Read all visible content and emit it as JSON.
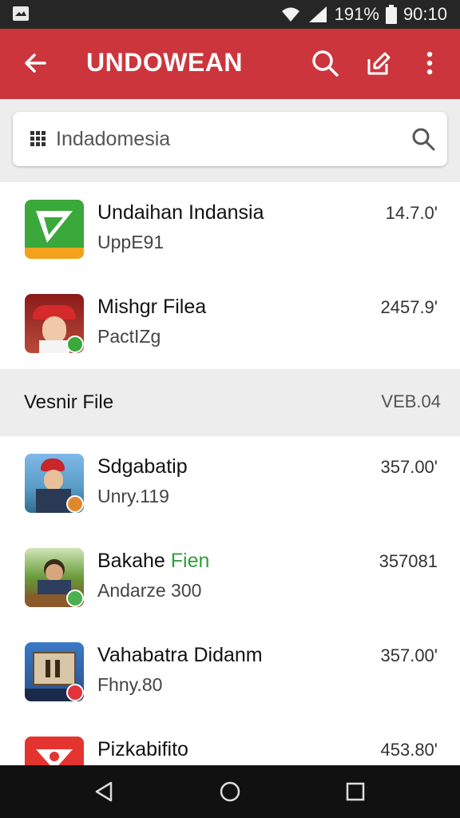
{
  "status": {
    "battery": "191%",
    "time": "90:10"
  },
  "header": {
    "title": "UNDOWEAN",
    "accent": "#cc353c"
  },
  "search": {
    "query": "Indadomesia"
  },
  "list_top": [
    {
      "name": "Undaihan Indansia",
      "sub": "UppE91",
      "value": "14.7.0'",
      "icon": "green-play-app-icon"
    },
    {
      "name": "Mishgr Filea",
      "sub": "PactIZg",
      "value": "2457.9'",
      "icon": "child-red-hat-photo-icon"
    }
  ],
  "section": {
    "label": "Vesnir File",
    "count": "VEB.04"
  },
  "list_bottom": [
    {
      "name": "Sdgabatip",
      "sub": "Unry.119",
      "value": "357.00'",
      "icon": "child-lake-photo-icon"
    },
    {
      "name": "Bakahe",
      "name_accent": "Fien",
      "sub": "Andarze 300",
      "value": "357081",
      "icon": "child-boat-photo-icon"
    },
    {
      "name": "Vahabatra Didanm",
      "sub": "Fhny.80",
      "value": "357.00'",
      "icon": "sign-board-photo-icon"
    },
    {
      "name": "Pizkabifito",
      "sub": "",
      "value": "453.80'",
      "icon": "red-eye-app-icon"
    }
  ],
  "colors": {
    "appbar": "#cc353c",
    "background": "#ededed",
    "green_accent": "#2f9e3b"
  }
}
